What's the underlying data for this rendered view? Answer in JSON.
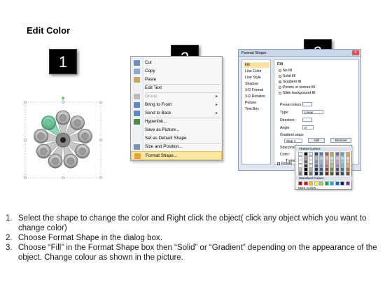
{
  "title": "Edit Color",
  "steps": [
    "1",
    "2",
    "3"
  ],
  "context_menu": {
    "items": [
      {
        "label": "Cut",
        "icon": "scissors-icon",
        "color": "#6a8ec4"
      },
      {
        "label": "Copy",
        "icon": "copy-icon",
        "color": "#8aa7cf"
      },
      {
        "label": "Paste",
        "icon": "clipboard-icon",
        "color": "#c9a85a"
      },
      {
        "label": "Edit Text",
        "icon": "",
        "color": ""
      },
      {
        "label": "Group",
        "icon": "group-icon",
        "color": "#bbbbbb",
        "arrow": true,
        "disabled": true
      },
      {
        "label": "Bring to Front",
        "icon": "bring-front-icon",
        "color": "#5c88c9",
        "arrow": true
      },
      {
        "label": "Send to Back",
        "icon": "send-back-icon",
        "color": "#5c88c9",
        "arrow": true
      },
      {
        "label": "Hyperlink...",
        "icon": "globe-icon",
        "color": "#4a8f3d"
      },
      {
        "label": "Save as Picture...",
        "icon": "",
        "color": ""
      },
      {
        "label": "Set as Default Shape",
        "icon": "",
        "color": ""
      },
      {
        "label": "Size and Position...",
        "icon": "size-icon",
        "color": "#7a93b8"
      },
      {
        "label": "Format Shape...",
        "icon": "format-shape-icon",
        "color": "#e0a43a",
        "highlight": true
      }
    ]
  },
  "dialog": {
    "title": "Format Shape",
    "close": "x",
    "nav": [
      "Fill",
      "Line Color",
      "Line Style",
      "Shadow",
      "3-D Format",
      "3-D Rotation",
      "Picture",
      "Text Box"
    ],
    "fill_heading": "Fill",
    "fill_options": [
      "No fill",
      "Solid fill",
      "Gradient fill",
      "Picture or texture fill",
      "Slide background fill"
    ],
    "selected_fill": 2,
    "labels": {
      "preset": "Preset colors:",
      "type": "Type:",
      "type_value": "Linear",
      "direction": "Direction:",
      "angle": "Angle:",
      "angle_value": "0°",
      "stops": "Gradient stops",
      "stop_value": "Stop 1",
      "add": "Add",
      "remove": "Remove",
      "stop_position": "Stop position:",
      "stop_position_value": "77%",
      "color": "Color:",
      "transparency": "Transpar",
      "rotate": "Rotate"
    }
  },
  "palette": {
    "theme_header": "Theme Colors",
    "standard_header": "Standard Colors",
    "more": "More Colors...",
    "theme_top": [
      "#ffffff",
      "#000000",
      "#eeece1",
      "#1f497d",
      "#4f81bd",
      "#c0504d",
      "#9bbb59",
      "#8064a2",
      "#4bacc6",
      "#f79646"
    ],
    "standard": [
      "#c00000",
      "#ff0000",
      "#ffc000",
      "#ffff00",
      "#92d050",
      "#00b050",
      "#00b0f0",
      "#0070c0",
      "#002060",
      "#7030a0"
    ]
  },
  "instructions": [
    {
      "num": "1.",
      "text": "Select the shape to change the color and Right click the object( click any object which you want to change color)"
    },
    {
      "num": "2.",
      "text": "Choose Format Shape in the dialog box."
    },
    {
      "num": "3.",
      "text": "Choose “Fill” in the Format Shape box then “Solid” or “Gradient” depending on the appearance of the object. Change colour as shown in the picture."
    }
  ],
  "accent_colors": {
    "selected_petal": "#5fbf8f",
    "petal": "#a6a6a6",
    "handle": "#7cc47c"
  }
}
